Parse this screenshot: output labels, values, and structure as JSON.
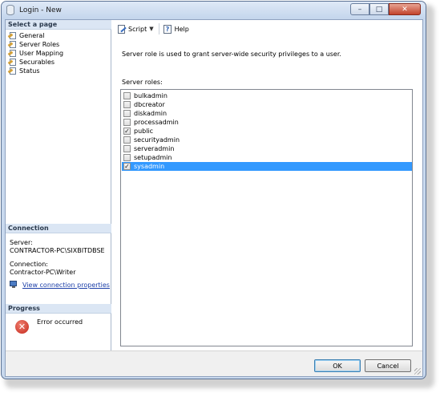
{
  "window": {
    "title": "Login - New",
    "minimize": "–",
    "maximize": "□",
    "close": "✕"
  },
  "left": {
    "select_page_header": "Select a page",
    "pages": [
      {
        "label": "General"
      },
      {
        "label": "Server Roles"
      },
      {
        "label": "User Mapping"
      },
      {
        "label": "Securables"
      },
      {
        "label": "Status"
      }
    ],
    "connection_header": "Connection",
    "server_label": "Server:",
    "server_value": "CONTRACTOR-PC\\SIXBITDBSE",
    "connection_label": "Connection:",
    "connection_value": "Contractor-PC\\Writer",
    "view_connection_link": "View connection properties",
    "progress_header": "Progress",
    "progress_status": "Error occurred"
  },
  "toolbar": {
    "script_label": "Script",
    "help_label": "Help"
  },
  "main": {
    "description": "Server role is used to grant server-wide security privileges to a user.",
    "roles_label": "Server roles:",
    "roles": [
      {
        "name": "bulkadmin",
        "checked": false
      },
      {
        "name": "dbcreator",
        "checked": false
      },
      {
        "name": "diskadmin",
        "checked": false
      },
      {
        "name": "processadmin",
        "checked": false
      },
      {
        "name": "public",
        "checked": true
      },
      {
        "name": "securityadmin",
        "checked": false
      },
      {
        "name": "serveradmin",
        "checked": false
      },
      {
        "name": "setupadmin",
        "checked": false
      },
      {
        "name": "sysadmin",
        "checked": true,
        "selected": true
      }
    ]
  },
  "buttons": {
    "ok": "OK",
    "cancel": "Cancel"
  },
  "colors": {
    "selection": "#3399ff",
    "section_header": "#dbe6f4",
    "link": "#1c3fa8",
    "error": "#c4261b"
  }
}
